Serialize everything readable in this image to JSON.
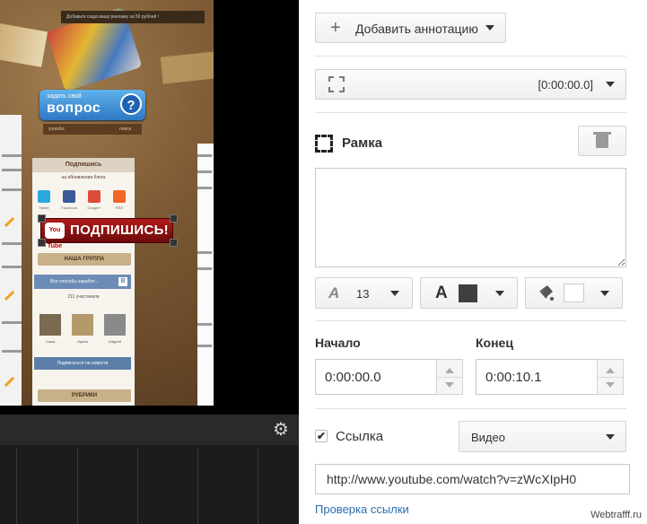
{
  "video": {
    "banner_top": "Добавьте сюда вашу рекламу за 50 рублей !",
    "ask_small": "задать свой",
    "ask_big": "вопрос",
    "ask_q": "?",
    "search_left": "youtube",
    "search_right": "поиск",
    "widget_title": "Подпишись",
    "widget_sub": "на обновления блога",
    "social_labels": [
      "Twitter",
      "Facebook",
      "Google+",
      "RSS"
    ],
    "annotation_text": "ПОДПИШИСЬ!",
    "yt_logo": "You Tube",
    "group_label": "НАША ГРУППА",
    "vk_label": "Все способы заработ...",
    "vk_icon": "В",
    "members": "211 участников",
    "avatar_names": [
      "Саша",
      "Ирина",
      "Андрей"
    ],
    "subscribe_news": "Подписаться на новости",
    "rubrics": "РУБРИКИ",
    "gear_icon": "⚙"
  },
  "panel": {
    "add_annotation_label": "Добавить аннотацию",
    "add_icon": "+",
    "type_time": "[0:00:00.0]",
    "section_title": "Рамка",
    "text_value": "",
    "font_size": "13",
    "font_size_icon": "A",
    "text_color_icon": "A",
    "text_color": "#3f3f3f",
    "bg_color": "#ffffff",
    "start_label": "Начало",
    "start_value": "0:00:00.0",
    "end_label": "Конец",
    "end_value": "0:00:10.1",
    "link_checked": true,
    "link_label": "Ссылка",
    "link_check_mark": "✔",
    "link_type": "Видео",
    "url_value": "http://www.youtube.com/watch?v=zWcXIpH0",
    "check_link_label": "Проверка ссылки"
  },
  "watermark": "Webtrafff.ru"
}
